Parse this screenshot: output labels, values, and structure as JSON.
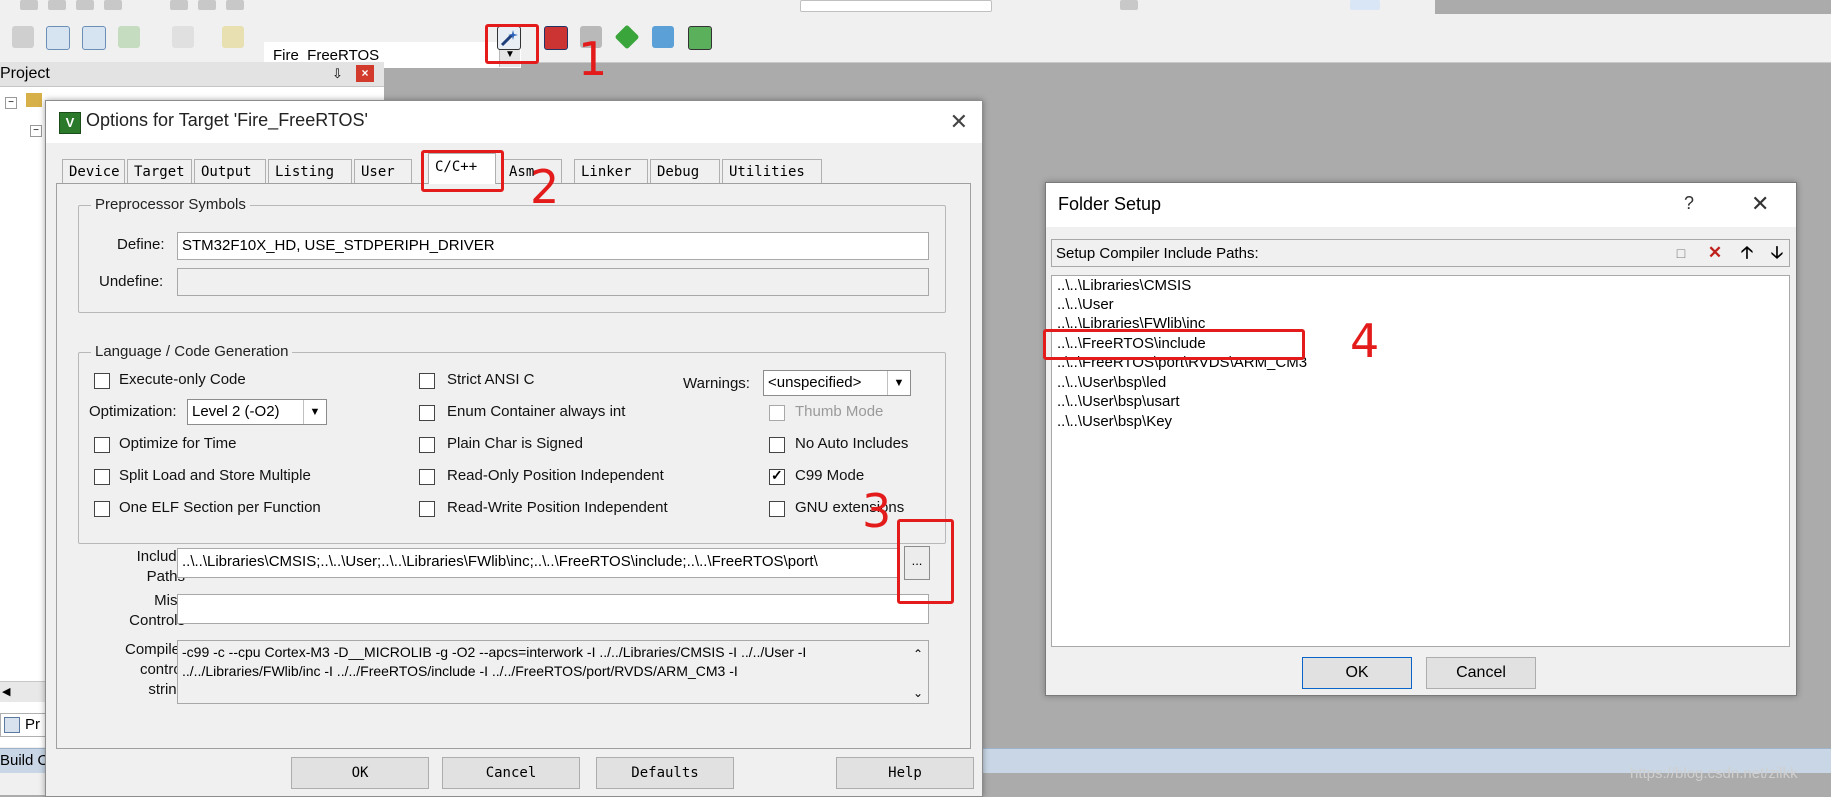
{
  "toolbar": {
    "target_name": "Fire_FreeRTOS"
  },
  "project_panel": {
    "title": "Project",
    "pin_label": "⇩",
    "close_label": "×",
    "tab_label": "Pr"
  },
  "options_dialog": {
    "title": "Options for Target 'Fire_FreeRTOS'",
    "app_icon": "V",
    "close_label": "✕",
    "tabs": [
      "Device",
      "Target",
      "Output",
      "Listing",
      "User",
      "C/C++",
      "Asm",
      "Linker",
      "Debug",
      "Utilities"
    ],
    "active_tab": "C/C++",
    "preprocessor": {
      "title": "Preprocessor Symbols",
      "define_label": "Define:",
      "define_value": "STM32F10X_HD, USE_STDPERIPH_DRIVER",
      "undefine_label": "Undefine:",
      "undefine_value": ""
    },
    "language": {
      "title": "Language / Code Generation",
      "execute_only": "Execute-only Code",
      "optimization_label": "Optimization:",
      "optimization_value": "Level 2 (-O2)",
      "optimize_time": "Optimize for Time",
      "split_load": "Split Load and Store Multiple",
      "one_elf": "One ELF Section per Function",
      "strict_ansi": "Strict ANSI C",
      "enum_container": "Enum Container always int",
      "plain_char": "Plain Char is Signed",
      "ro_pos": "Read-Only Position Independent",
      "rw_pos": "Read-Write Position Independent",
      "warnings_label": "Warnings:",
      "warnings_value": "<unspecified>",
      "thumb_mode": "Thumb Mode",
      "no_auto_includes": "No Auto Includes",
      "c99_mode": "C99 Mode",
      "gnu_extensions": "GNU extensions"
    },
    "include_paths_label_1": "Include",
    "include_paths_label_2": "Paths",
    "include_paths_value": "..\\..\\Libraries\\CMSIS;..\\..\\User;..\\..\\Libraries\\FWlib\\inc;..\\..\\FreeRTOS\\include;..\\..\\FreeRTOS\\port\\",
    "browse_label": "...",
    "misc_label_1": "Misc",
    "misc_label_2": "Controls",
    "misc_value": "",
    "compiler_label_1": "Compiler",
    "compiler_label_2": "control",
    "compiler_label_3": "string",
    "compiler_line_1": "-c99 -c --cpu Cortex-M3 -D__MICROLIB -g -O2 --apcs=interwork -I ../../Libraries/CMSIS -I ../../User -I",
    "compiler_line_2": "../../Libraries/FWlib/inc -I ../../FreeRTOS/include -I ../../FreeRTOS/port/RVDS/ARM_CM3 -I",
    "buttons": {
      "ok": "OK",
      "cancel": "Cancel",
      "defaults": "Defaults",
      "help": "Help"
    }
  },
  "folder_setup": {
    "title": "Folder Setup",
    "help_label": "?",
    "close_label": "✕",
    "list_header": "Setup Compiler Include Paths:",
    "paths": [
      "..\\..\\Libraries\\CMSIS",
      "..\\..\\User",
      "..\\..\\Libraries\\FWlib\\inc",
      "..\\..\\FreeRTOS\\include",
      "..\\..\\FreeRTOS\\port\\RVDS\\ARM_CM3",
      "..\\..\\User\\bsp\\led",
      "..\\..\\User\\bsp\\usart",
      "..\\..\\User\\bsp\\Key"
    ],
    "ok": "OK",
    "cancel": "Cancel"
  },
  "build_output": {
    "title": "Build O"
  },
  "watermark": "https://blog.csdn.net/zilkk",
  "annotations": [
    "1",
    "2",
    "3",
    "4"
  ],
  "colors": {
    "annotation_red": "#e31b1b",
    "active_tab_bg": "#ffffff",
    "dialog_bg": "#f0f0f0"
  }
}
